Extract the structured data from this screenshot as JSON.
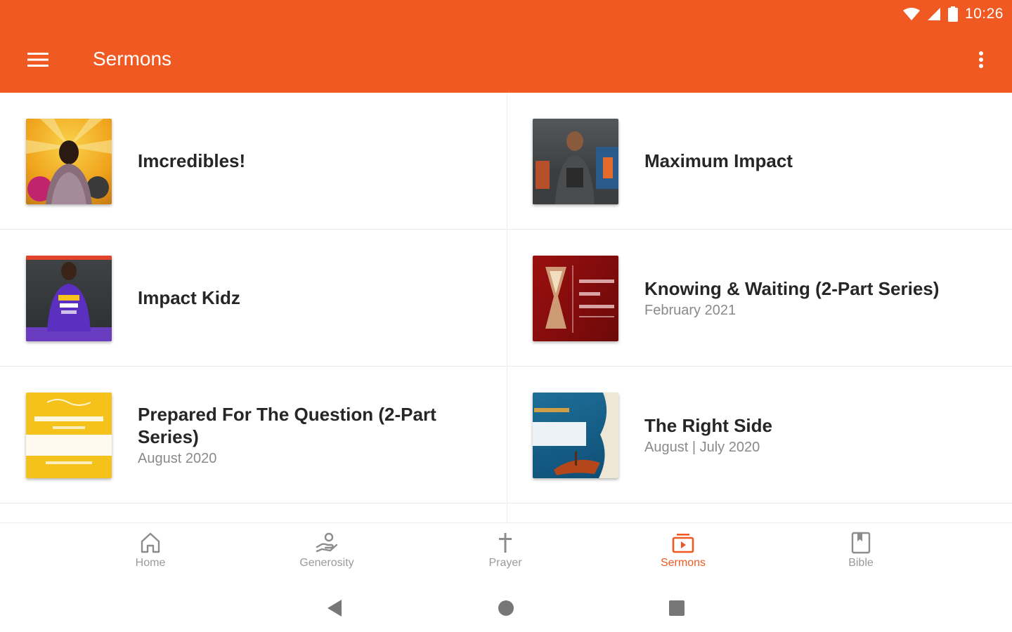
{
  "status": {
    "time": "10:26"
  },
  "app_bar": {
    "title": "Sermons"
  },
  "colors": {
    "accent": "#f05a22",
    "text_primary": "#262626",
    "text_secondary": "#8a8a8a",
    "nav_inactive": "#9a9a9a"
  },
  "sermons": [
    {
      "title": "Imcredibles!",
      "subtitle": ""
    },
    {
      "title": "Maximum Impact",
      "subtitle": ""
    },
    {
      "title": "Impact Kidz",
      "subtitle": ""
    },
    {
      "title": "Knowing & Waiting (2-Part Series)",
      "subtitle": "February 2021"
    },
    {
      "title": "Prepared For The Question (2-Part Series)",
      "subtitle": "August 2020"
    },
    {
      "title": "The Right Side",
      "subtitle": "August | July 2020"
    }
  ],
  "bottom_nav": [
    {
      "label": "Home",
      "icon": "home-icon"
    },
    {
      "label": "Generosity",
      "icon": "giving-hand-icon"
    },
    {
      "label": "Prayer",
      "icon": "cross-icon"
    },
    {
      "label": "Sermons",
      "icon": "video-play-icon",
      "active": true
    },
    {
      "label": "Bible",
      "icon": "book-icon"
    }
  ],
  "system_nav": [
    "back-icon",
    "home-circle-icon",
    "recents-square-icon"
  ]
}
